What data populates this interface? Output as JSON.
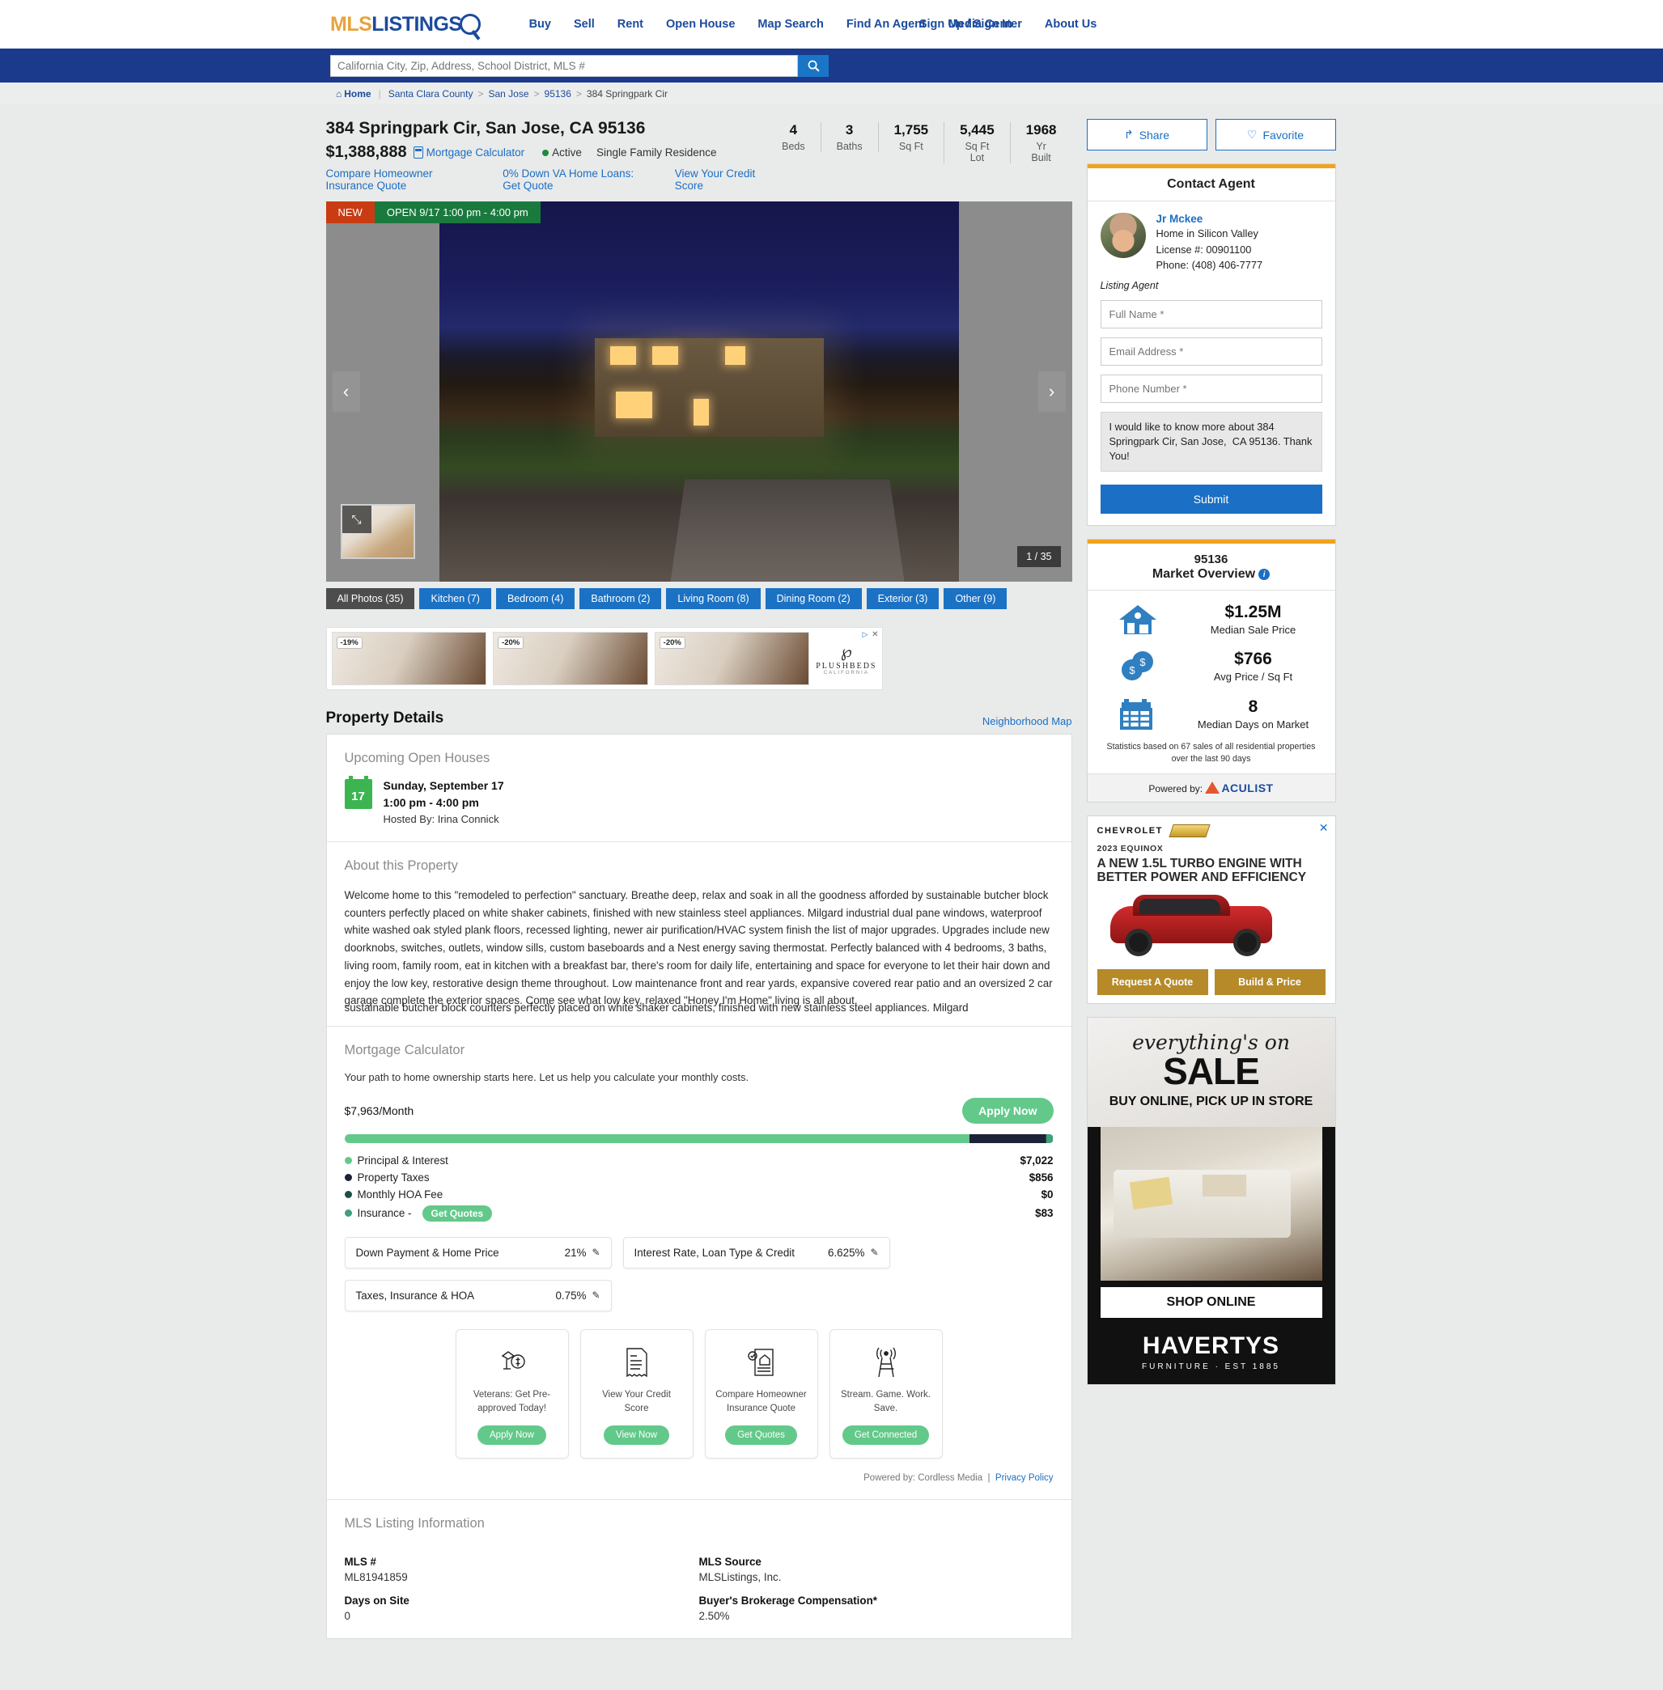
{
  "brand": {
    "part1": "MLS",
    "part2": "LISTINGS"
  },
  "nav": {
    "items": [
      "Buy",
      "Sell",
      "Rent",
      "Open House",
      "Map Search",
      "Find An Agent",
      "Media Center",
      "About Us"
    ],
    "signin": "Sign Up / Sign In"
  },
  "search": {
    "placeholder": "California City, Zip, Address, School District, MLS #",
    "value": ""
  },
  "breadcrumb": {
    "home": "Home",
    "items": [
      "Santa Clara County",
      "San Jose",
      "95136"
    ],
    "current": "384 Springpark Cir"
  },
  "listing": {
    "address": "384 Springpark Cir, San Jose, CA 95136",
    "price": "$1,388,888",
    "mortgage_calculator_link": "Mortgage Calculator",
    "status": "Active",
    "property_type": "Single Family Residence",
    "quick_links": [
      "Compare Homeowner Insurance Quote",
      "0% Down VA Home Loans: Get Quote",
      "View Your Credit Score"
    ],
    "facts": [
      {
        "value": "4",
        "label": "Beds"
      },
      {
        "value": "3",
        "label": "Baths"
      },
      {
        "value": "1,755",
        "label": "Sq Ft"
      },
      {
        "value": "5,445",
        "label": "Sq Ft Lot"
      },
      {
        "value": "1968",
        "label": "Yr Built"
      }
    ]
  },
  "gallery": {
    "badge_new": "NEW",
    "badge_open": "OPEN 9/17 1:00 pm - 4:00 pm",
    "counter": "1 / 35",
    "prev": "‹",
    "next": "›",
    "expand": "⤡",
    "categories": [
      {
        "label": "All Photos (35)",
        "active": true
      },
      {
        "label": "Kitchen (7)",
        "active": false
      },
      {
        "label": "Bedroom (4)",
        "active": false
      },
      {
        "label": "Bathroom (2)",
        "active": false
      },
      {
        "label": "Living Room (8)",
        "active": false
      },
      {
        "label": "Dining Room (2)",
        "active": false
      },
      {
        "label": "Exterior (3)",
        "active": false
      },
      {
        "label": "Other (9)",
        "active": false
      }
    ]
  },
  "ad_strip": {
    "discounts": [
      "-19%",
      "-20%",
      "-20%"
    ],
    "logo_mark": "℘",
    "logo_name": "PLUSHBEDS",
    "logo_sub": "CALIFORNIA",
    "close": "✕"
  },
  "property_details": {
    "title": "Property Details",
    "map_link": "Neighborhood Map",
    "open_houses": {
      "heading": "Upcoming Open Houses",
      "day_number": "17",
      "date": "Sunday, September 17",
      "time": "1:00 pm - 4:00 pm",
      "host": "Hosted By: Irina Connick"
    },
    "about": {
      "heading": "About this Property",
      "ghost_line": "sustainable butcher block counters perfectly placed on white shaker cabinets, finished with new stainless steel appliances. Milgard",
      "text": "Welcome home to this \"remodeled to perfection\" sanctuary. Breathe deep, relax and soak in all the goodness afforded by sustainable butcher block counters perfectly placed on white shaker cabinets, finished with new stainless steel appliances. Milgard industrial dual pane windows, waterproof white washed oak styled plank floors, recessed lighting, newer air purification/HVAC system finish the list of major upgrades. Upgrades include new doorknobs, switches, outlets, window sills, custom baseboards and a Nest energy saving thermostat. Perfectly balanced with 4 bedrooms, 3 baths, living room, family room, eat in kitchen with a breakfast bar, there's room for daily life, entertaining and space for everyone to let their hair down and enjoy the low key, restorative design theme throughout. Low maintenance front and rear yards, expansive covered rear patio and an oversized 2 car garage complete the exterior spaces. Come see what low key, relaxed \"Honey I'm Home\" living is all about."
    },
    "mortgage": {
      "heading": "Mortgage Calculator",
      "subtitle": "Your path to home ownership starts here. Let us help you calculate your monthly costs.",
      "monthly_amount": "$7,963",
      "monthly_suffix": "/Month",
      "apply_label": "Apply Now",
      "breakdown": [
        {
          "label": "Principal & Interest",
          "value": "$7,022",
          "color": "#63c98a",
          "pct": 88.2
        },
        {
          "label": "Property Taxes",
          "value": "$856",
          "color": "#1d2336",
          "pct": 10.7
        },
        {
          "label": "Monthly HOA Fee",
          "value": "$0",
          "color": "#1e4f47",
          "pct": 0.1
        },
        {
          "label": "Insurance - ",
          "value": "$83",
          "color": "#3fa07a",
          "pct": 1.0
        }
      ],
      "insurance_button": "Get Quotes",
      "inputs": [
        {
          "label": "Down Payment & Home Price",
          "value": "21%"
        },
        {
          "label": "Interest Rate, Loan Type & Credit",
          "value": "6.625%"
        },
        {
          "label": "Taxes, Insurance & HOA",
          "value": "0.75%"
        }
      ],
      "promos": [
        {
          "icon": "veteran-money-icon",
          "text": "Veterans: Get Pre-approved Today!",
          "button": "Apply Now"
        },
        {
          "icon": "receipt-icon",
          "text": "View Your Credit Score",
          "button": "View Now"
        },
        {
          "icon": "home-document-icon",
          "text": "Compare Homeowner Insurance Quote",
          "button": "Get Quotes"
        },
        {
          "icon": "antenna-tower-icon",
          "text": "Stream. Game. Work. Save.",
          "button": "Get Connected"
        }
      ],
      "powered_by": "Powered by: Cordless Media",
      "privacy": "Privacy Policy"
    },
    "mls_info": {
      "heading": "MLS Listing Information",
      "fields": [
        {
          "key": "MLS #",
          "value": "ML81941859"
        },
        {
          "key": "MLS Source",
          "value": "MLSListings, Inc."
        },
        {
          "key": "Days on Site",
          "value": "0"
        },
        {
          "key": "Buyer's Brokerage Compensation*",
          "value": "2.50%"
        }
      ]
    }
  },
  "sidebar": {
    "share_label": "Share",
    "favorite_label": "Favorite",
    "contact": {
      "title": "Contact Agent",
      "agent_name": "Jr Mckee",
      "agent_company": "Home in Silicon Valley",
      "agent_license": "License #: 00901100",
      "agent_phone": "Phone: (408) 406-7777",
      "agent_role": "Listing Agent",
      "full_name_placeholder": "Full Name *",
      "email_placeholder": "Email Address *",
      "phone_placeholder": "Phone Number *",
      "message": "I would like to know more about 384 Springpark Cir, San Jose,  CA 95136. Thank You!",
      "submit_label": "Submit"
    },
    "market": {
      "zip": "95136",
      "title": "Market Overview",
      "stats": [
        {
          "icon": "house-icon",
          "value": "$1.25M",
          "label": "Median Sale Price"
        },
        {
          "icon": "coins-icon",
          "value": "$766",
          "label": "Avg Price / Sq Ft"
        },
        {
          "icon": "calendar-icon",
          "value": "8",
          "label": "Median Days on Market"
        }
      ],
      "note": "Statistics based on 67 sales of all residential properties over the last 90 days",
      "powered_by": "Powered by:",
      "provider": "ACULIST"
    }
  },
  "ads": {
    "chevy": {
      "wordmark": "CHEVROLET",
      "model": "2023 EQUINOX",
      "headline": "A NEW 1.5L TURBO ENGINE WITH BETTER POWER AND EFFICIENCY",
      "button1": "Request A Quote",
      "button2": "Build & Price",
      "close": "✕"
    },
    "havertys": {
      "script": "everything's on",
      "sale": "SALE",
      "sub": "BUY ONLINE, PICK UP IN STORE",
      "shop": "SHOP ONLINE",
      "brand": "HAVERTYS",
      "tagline": "FURNITURE · EST 1885"
    }
  }
}
